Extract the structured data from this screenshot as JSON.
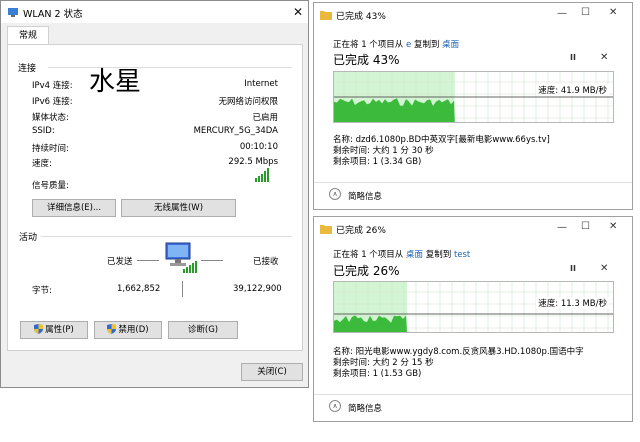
{
  "wlan": {
    "title": "WLAN 2 状态",
    "close": "✕",
    "tab": "常规",
    "handwriting": "水星",
    "connection_label": "连接",
    "rows": [
      {
        "label": "IPv4 连接:",
        "value": "Internet"
      },
      {
        "label": "IPv6 连接:",
        "value": "无网络访问权限"
      },
      {
        "label": "媒体状态:",
        "value": "已启用"
      },
      {
        "label": "SSID:",
        "value": "MERCURY_5G_34DA"
      },
      {
        "label": "持续时间:",
        "value": "00:10:10"
      },
      {
        "label": "速度:",
        "value": "292.5 Mbps"
      }
    ],
    "signal_label": "信号质量:",
    "details_btn": "详细信息(E)...",
    "wireless_btn": "无线属性(W)",
    "activity_label": "活动",
    "sent_label": "已发送",
    "recv_label": "已接收",
    "bytes_label": "字节:",
    "bytes_sent": "1,662,852",
    "bytes_recv": "39,122,900",
    "props_btn": "属性(P)",
    "disable_btn": "禁用(D)",
    "diag_btn": "诊断(G)",
    "close_btn": "关闭(C)"
  },
  "copy1": {
    "title": "已完成 43%",
    "source_prefix": "正在将 1 个项目从 ",
    "source_from": "e",
    "source_mid": " 复制到 ",
    "source_to": "桌面",
    "done_text": "已完成 43%",
    "progress": 0.43,
    "speed": "速度: 41.9 MB/秒",
    "name": "名称:  dzd6.1080p.BD中英双字[最新电影www.66ys.tv]",
    "remaining_time": "剩余时间:  大约 1 分 30 秒",
    "remaining_items": "剩余项目:  1 (3.34 GB)",
    "summary": "简略信息"
  },
  "copy2": {
    "title": "已完成 26%",
    "source_prefix": "正在将 1 个项目从 ",
    "source_from": "桌面",
    "source_mid": " 复制到 ",
    "source_to": "test",
    "done_text": "已完成 26%",
    "progress": 0.26,
    "speed": "速度: 11.3 MB/秒",
    "name": "名称:  阳光电影www.ygdy8.com.反贪风暴3.HD.1080p.国语中字",
    "remaining_time": "剩余时间:  大约 2 分 15 秒",
    "remaining_items": "剩余项目:  1 (1.53 GB)",
    "summary": "简略信息"
  },
  "controls": {
    "minimize": "—",
    "maximize": "☐",
    "close": "✕",
    "pause": "II"
  },
  "colors": {
    "graph_fill": "#3cba3c",
    "graph_bg": "#d4f5d4",
    "link": "#1a62b8"
  }
}
